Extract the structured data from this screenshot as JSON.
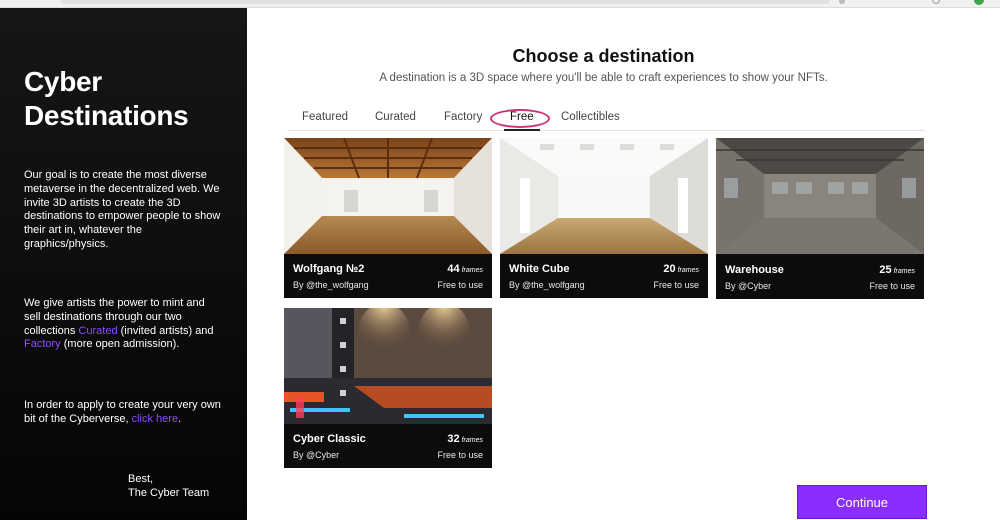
{
  "sidebar": {
    "title": "Cyber Destinations",
    "paragraph1": "Our goal is to create the most diverse metaverse in the decentralized web. We invite 3D artists to create the 3D destinations to empower people to show their art in, whatever the graphics/physics.",
    "paragraph2_before": "We give artists the power to mint and sell destinations through our two collections ",
    "paragraph2_link1": "Curated",
    "paragraph2_middle": " (invited artists) and ",
    "paragraph2_link2": "Factory",
    "paragraph2_after": " (more open admission).",
    "paragraph3_before": "In order to apply to create your very own bit of the Cyberverse, ",
    "paragraph3_link": "click here",
    "paragraph3_after": ".",
    "signoff_line1": "Best,",
    "signoff_line2": "The Cyber Team",
    "link_color": "#8b4dff"
  },
  "main": {
    "heading": "Choose a destination",
    "subheading": "A destination is a 3D space where you'll be able to craft experiences to show your NFTs.",
    "tabs": [
      {
        "label": "Featured"
      },
      {
        "label": "Curated"
      },
      {
        "label": "Factory"
      },
      {
        "label": "Free",
        "active": true
      },
      {
        "label": "Collectibles"
      }
    ],
    "active_tab": "Free",
    "highlight_color": "#d0357a",
    "cards": [
      {
        "name": "Wolfgang №2",
        "count": "44",
        "unit": "frames",
        "author": "By @the_wolfgang",
        "price": "Free to use"
      },
      {
        "name": "White Cube",
        "count": "20",
        "unit": "frames",
        "author": "By @the_wolfgang",
        "price": "Free to use"
      },
      {
        "name": "Warehouse",
        "count": "25",
        "unit": "frames",
        "author": "By @Cyber",
        "price": "Free to use"
      },
      {
        "name": "Cyber Classic",
        "count": "32",
        "unit": "frames",
        "author": "By @Cyber",
        "price": "Free to use"
      }
    ],
    "continue_label": "Continue",
    "accent_color": "#8a2eff"
  }
}
